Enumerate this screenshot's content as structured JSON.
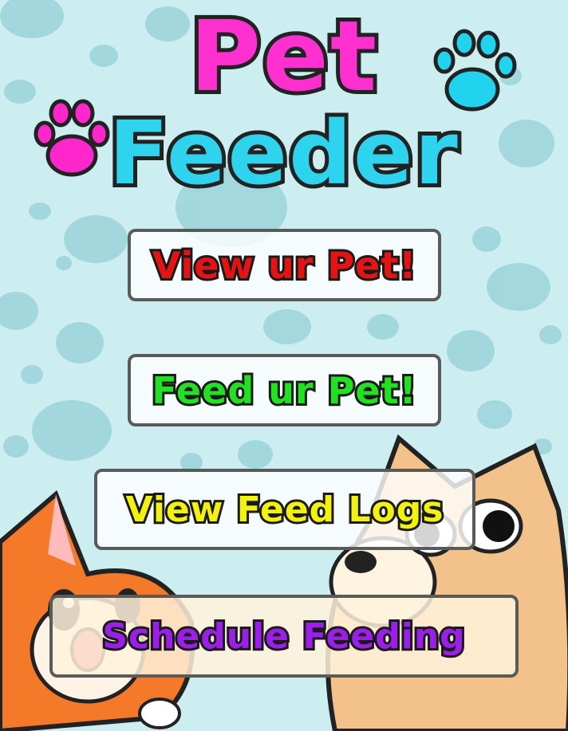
{
  "header": {
    "title_line1": "Pet",
    "title_line2": "Feeder"
  },
  "menu": [
    {
      "label": "View ur Pet!",
      "color": "#e51414"
    },
    {
      "label": "Feed ur Pet!",
      "color": "#22e022"
    },
    {
      "label": "View Feed Logs",
      "color": "#f2f20d"
    },
    {
      "label": "Schedule Feeding",
      "color": "#9b1fe8"
    }
  ],
  "decor": {
    "paw_left_color": "#ff26cc",
    "paw_right_color": "#22d3f0",
    "icons": [
      "pink-paw-icon",
      "cyan-paw-icon",
      "cat-illustration",
      "dog-illustration"
    ]
  }
}
